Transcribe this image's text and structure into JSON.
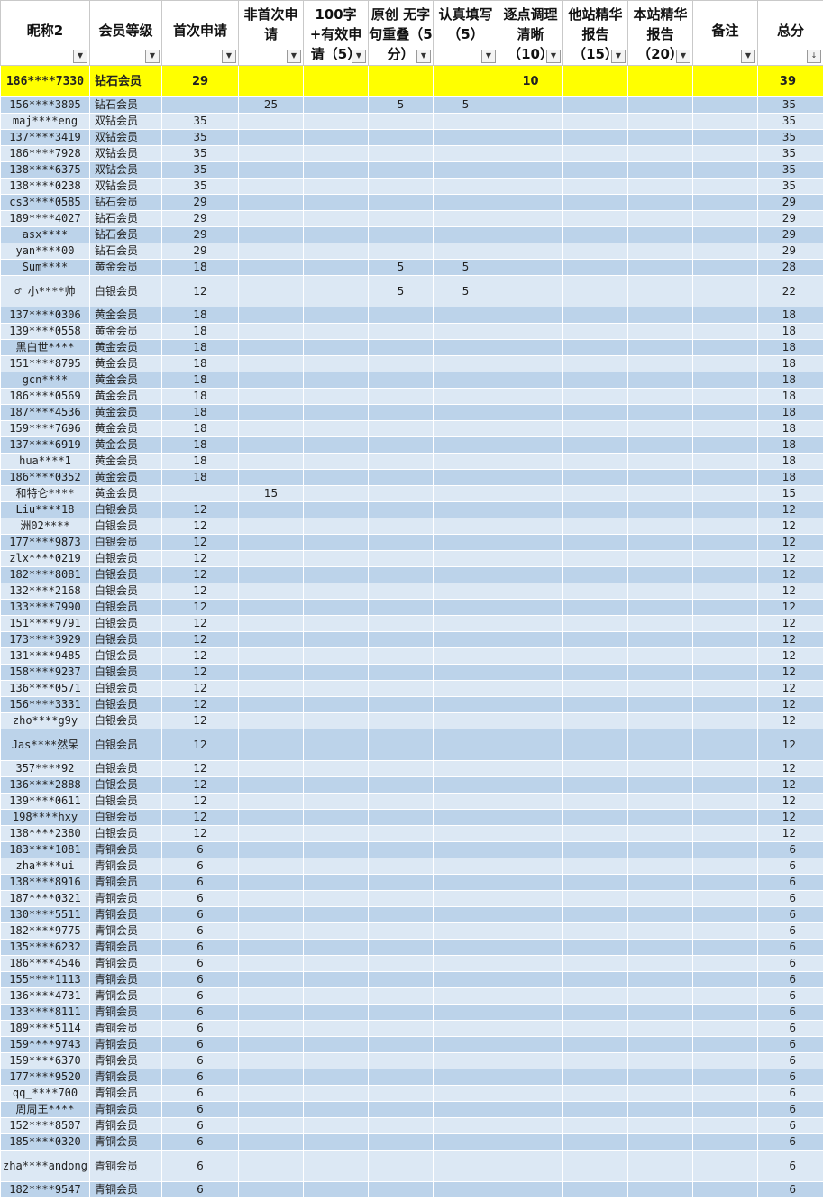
{
  "headers": [
    {
      "label": "昵称2",
      "lines": 1
    },
    {
      "label": "会员等级",
      "lines": 1
    },
    {
      "label": "首次申请",
      "lines": 1
    },
    {
      "label": "非首次申请",
      "lines": 2
    },
    {
      "label": "100字+有效申请（5）",
      "lines": 3
    },
    {
      "label": "原创 无字句重叠（5分）",
      "lines": 3
    },
    {
      "label": "认真填写（5）",
      "lines": 2
    },
    {
      "label": "逐点调理清晰（10）",
      "lines": 3
    },
    {
      "label": "他站精华报告（15）",
      "lines": 3
    },
    {
      "label": "本站精华报告（20）",
      "lines": 3
    },
    {
      "label": "备注",
      "lines": 1
    },
    {
      "label": "总分",
      "lines": 1
    }
  ],
  "sort_icon": "sort-desc",
  "filter_icon": "dropdown-arrow",
  "rows": [
    {
      "name": "186****7330",
      "level": "钻石会员",
      "first": "29",
      "nonfirst": "",
      "valid100": "",
      "original": "",
      "careful": "",
      "clear": "10",
      "other": "",
      "local": "",
      "note": "",
      "total": "39",
      "style": "hl"
    },
    {
      "name": "156****3805",
      "level": "钻石会员",
      "first": "",
      "nonfirst": "25",
      "valid100": "",
      "original": "5",
      "careful": "5",
      "clear": "",
      "other": "",
      "local": "",
      "note": "",
      "total": "35"
    },
    {
      "name": "maj****eng",
      "level": "双钻会员",
      "first": "35",
      "nonfirst": "",
      "valid100": "",
      "original": "",
      "careful": "",
      "clear": "",
      "other": "",
      "local": "",
      "note": "",
      "total": "35"
    },
    {
      "name": "137****3419",
      "level": "双钻会员",
      "first": "35",
      "nonfirst": "",
      "valid100": "",
      "original": "",
      "careful": "",
      "clear": "",
      "other": "",
      "local": "",
      "note": "",
      "total": "35"
    },
    {
      "name": "186****7928",
      "level": "双钻会员",
      "first": "35",
      "nonfirst": "",
      "valid100": "",
      "original": "",
      "careful": "",
      "clear": "",
      "other": "",
      "local": "",
      "note": "",
      "total": "35"
    },
    {
      "name": "138****6375",
      "level": "双钻会员",
      "first": "35",
      "nonfirst": "",
      "valid100": "",
      "original": "",
      "careful": "",
      "clear": "",
      "other": "",
      "local": "",
      "note": "",
      "total": "35"
    },
    {
      "name": "138****0238",
      "level": "双钻会员",
      "first": "35",
      "nonfirst": "",
      "valid100": "",
      "original": "",
      "careful": "",
      "clear": "",
      "other": "",
      "local": "",
      "note": "",
      "total": "35"
    },
    {
      "name": "cs3****0585",
      "level": "钻石会员",
      "first": "29",
      "nonfirst": "",
      "valid100": "",
      "original": "",
      "careful": "",
      "clear": "",
      "other": "",
      "local": "",
      "note": "",
      "total": "29"
    },
    {
      "name": "189****4027",
      "level": "钻石会员",
      "first": "29",
      "nonfirst": "",
      "valid100": "",
      "original": "",
      "careful": "",
      "clear": "",
      "other": "",
      "local": "",
      "note": "",
      "total": "29"
    },
    {
      "name": "asx****",
      "level": "钻石会员",
      "first": "29",
      "nonfirst": "",
      "valid100": "",
      "original": "",
      "careful": "",
      "clear": "",
      "other": "",
      "local": "",
      "note": "",
      "total": "29"
    },
    {
      "name": "yan****00",
      "level": "钻石会员",
      "first": "29",
      "nonfirst": "",
      "valid100": "",
      "original": "",
      "careful": "",
      "clear": "",
      "other": "",
      "local": "",
      "note": "",
      "total": "29"
    },
    {
      "name": "Sum****",
      "level": "黄金会员",
      "first": "18",
      "nonfirst": "",
      "valid100": "",
      "original": "5",
      "careful": "5",
      "clear": "",
      "other": "",
      "local": "",
      "note": "",
      "total": "28"
    },
    {
      "name": "♂ 小****帅",
      "level": "白银会员",
      "first": "12",
      "nonfirst": "",
      "valid100": "",
      "original": "5",
      "careful": "5",
      "clear": "",
      "other": "",
      "local": "",
      "note": "",
      "total": "22",
      "style": "tall"
    },
    {
      "name": "137****0306",
      "level": "黄金会员",
      "first": "18",
      "nonfirst": "",
      "valid100": "",
      "original": "",
      "careful": "",
      "clear": "",
      "other": "",
      "local": "",
      "note": "",
      "total": "18"
    },
    {
      "name": "139****0558",
      "level": "黄金会员",
      "first": "18",
      "nonfirst": "",
      "valid100": "",
      "original": "",
      "careful": "",
      "clear": "",
      "other": "",
      "local": "",
      "note": "",
      "total": "18"
    },
    {
      "name": "黑白世****",
      "level": "黄金会员",
      "first": "18",
      "nonfirst": "",
      "valid100": "",
      "original": "",
      "careful": "",
      "clear": "",
      "other": "",
      "local": "",
      "note": "",
      "total": "18"
    },
    {
      "name": "151****8795",
      "level": "黄金会员",
      "first": "18",
      "nonfirst": "",
      "valid100": "",
      "original": "",
      "careful": "",
      "clear": "",
      "other": "",
      "local": "",
      "note": "",
      "total": "18"
    },
    {
      "name": "gcn****",
      "level": "黄金会员",
      "first": "18",
      "nonfirst": "",
      "valid100": "",
      "original": "",
      "careful": "",
      "clear": "",
      "other": "",
      "local": "",
      "note": "",
      "total": "18"
    },
    {
      "name": "186****0569",
      "level": "黄金会员",
      "first": "18",
      "nonfirst": "",
      "valid100": "",
      "original": "",
      "careful": "",
      "clear": "",
      "other": "",
      "local": "",
      "note": "",
      "total": "18"
    },
    {
      "name": "187****4536",
      "level": "黄金会员",
      "first": "18",
      "nonfirst": "",
      "valid100": "",
      "original": "",
      "careful": "",
      "clear": "",
      "other": "",
      "local": "",
      "note": "",
      "total": "18"
    },
    {
      "name": "159****7696",
      "level": "黄金会员",
      "first": "18",
      "nonfirst": "",
      "valid100": "",
      "original": "",
      "careful": "",
      "clear": "",
      "other": "",
      "local": "",
      "note": "",
      "total": "18"
    },
    {
      "name": "137****6919",
      "level": "黄金会员",
      "first": "18",
      "nonfirst": "",
      "valid100": "",
      "original": "",
      "careful": "",
      "clear": "",
      "other": "",
      "local": "",
      "note": "",
      "total": "18"
    },
    {
      "name": "hua****1",
      "level": "黄金会员",
      "first": "18",
      "nonfirst": "",
      "valid100": "",
      "original": "",
      "careful": "",
      "clear": "",
      "other": "",
      "local": "",
      "note": "",
      "total": "18"
    },
    {
      "name": "186****0352",
      "level": "黄金会员",
      "first": "18",
      "nonfirst": "",
      "valid100": "",
      "original": "",
      "careful": "",
      "clear": "",
      "other": "",
      "local": "",
      "note": "",
      "total": "18"
    },
    {
      "name": "和特仑****",
      "level": "黄金会员",
      "first": "",
      "nonfirst": "15",
      "valid100": "",
      "original": "",
      "careful": "",
      "clear": "",
      "other": "",
      "local": "",
      "note": "",
      "total": "15"
    },
    {
      "name": "Liu****18",
      "level": "白银会员",
      "first": "12",
      "nonfirst": "",
      "valid100": "",
      "original": "",
      "careful": "",
      "clear": "",
      "other": "",
      "local": "",
      "note": "",
      "total": "12"
    },
    {
      "name": "洲02****",
      "level": "白银会员",
      "first": "12",
      "nonfirst": "",
      "valid100": "",
      "original": "",
      "careful": "",
      "clear": "",
      "other": "",
      "local": "",
      "note": "",
      "total": "12"
    },
    {
      "name": "177****9873",
      "level": "白银会员",
      "first": "12",
      "nonfirst": "",
      "valid100": "",
      "original": "",
      "careful": "",
      "clear": "",
      "other": "",
      "local": "",
      "note": "",
      "total": "12"
    },
    {
      "name": "zlx****0219",
      "level": "白银会员",
      "first": "12",
      "nonfirst": "",
      "valid100": "",
      "original": "",
      "careful": "",
      "clear": "",
      "other": "",
      "local": "",
      "note": "",
      "total": "12"
    },
    {
      "name": "182****8081",
      "level": "白银会员",
      "first": "12",
      "nonfirst": "",
      "valid100": "",
      "original": "",
      "careful": "",
      "clear": "",
      "other": "",
      "local": "",
      "note": "",
      "total": "12"
    },
    {
      "name": "132****2168",
      "level": "白银会员",
      "first": "12",
      "nonfirst": "",
      "valid100": "",
      "original": "",
      "careful": "",
      "clear": "",
      "other": "",
      "local": "",
      "note": "",
      "total": "12"
    },
    {
      "name": "133****7990",
      "level": "白银会员",
      "first": "12",
      "nonfirst": "",
      "valid100": "",
      "original": "",
      "careful": "",
      "clear": "",
      "other": "",
      "local": "",
      "note": "",
      "total": "12"
    },
    {
      "name": "151****9791",
      "level": "白银会员",
      "first": "12",
      "nonfirst": "",
      "valid100": "",
      "original": "",
      "careful": "",
      "clear": "",
      "other": "",
      "local": "",
      "note": "",
      "total": "12"
    },
    {
      "name": "173****3929",
      "level": "白银会员",
      "first": "12",
      "nonfirst": "",
      "valid100": "",
      "original": "",
      "careful": "",
      "clear": "",
      "other": "",
      "local": "",
      "note": "",
      "total": "12"
    },
    {
      "name": "131****9485",
      "level": "白银会员",
      "first": "12",
      "nonfirst": "",
      "valid100": "",
      "original": "",
      "careful": "",
      "clear": "",
      "other": "",
      "local": "",
      "note": "",
      "total": "12"
    },
    {
      "name": "158****9237",
      "level": "白银会员",
      "first": "12",
      "nonfirst": "",
      "valid100": "",
      "original": "",
      "careful": "",
      "clear": "",
      "other": "",
      "local": "",
      "note": "",
      "total": "12"
    },
    {
      "name": "136****0571",
      "level": "白银会员",
      "first": "12",
      "nonfirst": "",
      "valid100": "",
      "original": "",
      "careful": "",
      "clear": "",
      "other": "",
      "local": "",
      "note": "",
      "total": "12"
    },
    {
      "name": "156****3331",
      "level": "白银会员",
      "first": "12",
      "nonfirst": "",
      "valid100": "",
      "original": "",
      "careful": "",
      "clear": "",
      "other": "",
      "local": "",
      "note": "",
      "total": "12"
    },
    {
      "name": "zho****g9y",
      "level": "白银会员",
      "first": "12",
      "nonfirst": "",
      "valid100": "",
      "original": "",
      "careful": "",
      "clear": "",
      "other": "",
      "local": "",
      "note": "",
      "total": "12"
    },
    {
      "name": "Jas****然呆",
      "level": "白银会员",
      "first": "12",
      "nonfirst": "",
      "valid100": "",
      "original": "",
      "careful": "",
      "clear": "",
      "other": "",
      "local": "",
      "note": "",
      "total": "12",
      "style": "tall"
    },
    {
      "name": "357****92",
      "level": "白银会员",
      "first": "12",
      "nonfirst": "",
      "valid100": "",
      "original": "",
      "careful": "",
      "clear": "",
      "other": "",
      "local": "",
      "note": "",
      "total": "12"
    },
    {
      "name": "136****2888",
      "level": "白银会员",
      "first": "12",
      "nonfirst": "",
      "valid100": "",
      "original": "",
      "careful": "",
      "clear": "",
      "other": "",
      "local": "",
      "note": "",
      "total": "12"
    },
    {
      "name": "139****0611",
      "level": "白银会员",
      "first": "12",
      "nonfirst": "",
      "valid100": "",
      "original": "",
      "careful": "",
      "clear": "",
      "other": "",
      "local": "",
      "note": "",
      "total": "12"
    },
    {
      "name": "198****hxy",
      "level": "白银会员",
      "first": "12",
      "nonfirst": "",
      "valid100": "",
      "original": "",
      "careful": "",
      "clear": "",
      "other": "",
      "local": "",
      "note": "",
      "total": "12"
    },
    {
      "name": "138****2380",
      "level": "白银会员",
      "first": "12",
      "nonfirst": "",
      "valid100": "",
      "original": "",
      "careful": "",
      "clear": "",
      "other": "",
      "local": "",
      "note": "",
      "total": "12"
    },
    {
      "name": "183****1081",
      "level": "青铜会员",
      "first": "6",
      "nonfirst": "",
      "valid100": "",
      "original": "",
      "careful": "",
      "clear": "",
      "other": "",
      "local": "",
      "note": "",
      "total": "6"
    },
    {
      "name": "zha****ui",
      "level": "青铜会员",
      "first": "6",
      "nonfirst": "",
      "valid100": "",
      "original": "",
      "careful": "",
      "clear": "",
      "other": "",
      "local": "",
      "note": "",
      "total": "6"
    },
    {
      "name": "138****8916",
      "level": "青铜会员",
      "first": "6",
      "nonfirst": "",
      "valid100": "",
      "original": "",
      "careful": "",
      "clear": "",
      "other": "",
      "local": "",
      "note": "",
      "total": "6"
    },
    {
      "name": "187****0321",
      "level": "青铜会员",
      "first": "6",
      "nonfirst": "",
      "valid100": "",
      "original": "",
      "careful": "",
      "clear": "",
      "other": "",
      "local": "",
      "note": "",
      "total": "6"
    },
    {
      "name": "130****5511",
      "level": "青铜会员",
      "first": "6",
      "nonfirst": "",
      "valid100": "",
      "original": "",
      "careful": "",
      "clear": "",
      "other": "",
      "local": "",
      "note": "",
      "total": "6"
    },
    {
      "name": "182****9775",
      "level": "青铜会员",
      "first": "6",
      "nonfirst": "",
      "valid100": "",
      "original": "",
      "careful": "",
      "clear": "",
      "other": "",
      "local": "",
      "note": "",
      "total": "6"
    },
    {
      "name": "135****6232",
      "level": "青铜会员",
      "first": "6",
      "nonfirst": "",
      "valid100": "",
      "original": "",
      "careful": "",
      "clear": "",
      "other": "",
      "local": "",
      "note": "",
      "total": "6"
    },
    {
      "name": "186****4546",
      "level": "青铜会员",
      "first": "6",
      "nonfirst": "",
      "valid100": "",
      "original": "",
      "careful": "",
      "clear": "",
      "other": "",
      "local": "",
      "note": "",
      "total": "6"
    },
    {
      "name": "155****1113",
      "level": "青铜会员",
      "first": "6",
      "nonfirst": "",
      "valid100": "",
      "original": "",
      "careful": "",
      "clear": "",
      "other": "",
      "local": "",
      "note": "",
      "total": "6"
    },
    {
      "name": "136****4731",
      "level": "青铜会员",
      "first": "6",
      "nonfirst": "",
      "valid100": "",
      "original": "",
      "careful": "",
      "clear": "",
      "other": "",
      "local": "",
      "note": "",
      "total": "6"
    },
    {
      "name": "133****8111",
      "level": "青铜会员",
      "first": "6",
      "nonfirst": "",
      "valid100": "",
      "original": "",
      "careful": "",
      "clear": "",
      "other": "",
      "local": "",
      "note": "",
      "total": "6"
    },
    {
      "name": "189****5114",
      "level": "青铜会员",
      "first": "6",
      "nonfirst": "",
      "valid100": "",
      "original": "",
      "careful": "",
      "clear": "",
      "other": "",
      "local": "",
      "note": "",
      "total": "6"
    },
    {
      "name": "159****9743",
      "level": "青铜会员",
      "first": "6",
      "nonfirst": "",
      "valid100": "",
      "original": "",
      "careful": "",
      "clear": "",
      "other": "",
      "local": "",
      "note": "",
      "total": "6"
    },
    {
      "name": "159****6370",
      "level": "青铜会员",
      "first": "6",
      "nonfirst": "",
      "valid100": "",
      "original": "",
      "careful": "",
      "clear": "",
      "other": "",
      "local": "",
      "note": "",
      "total": "6"
    },
    {
      "name": "177****9520",
      "level": "青铜会员",
      "first": "6",
      "nonfirst": "",
      "valid100": "",
      "original": "",
      "careful": "",
      "clear": "",
      "other": "",
      "local": "",
      "note": "",
      "total": "6"
    },
    {
      "name": "qq_****700",
      "level": "青铜会员",
      "first": "6",
      "nonfirst": "",
      "valid100": "",
      "original": "",
      "careful": "",
      "clear": "",
      "other": "",
      "local": "",
      "note": "",
      "total": "6"
    },
    {
      "name": "周周王****",
      "level": "青铜会员",
      "first": "6",
      "nonfirst": "",
      "valid100": "",
      "original": "",
      "careful": "",
      "clear": "",
      "other": "",
      "local": "",
      "note": "",
      "total": "6"
    },
    {
      "name": "152****8507",
      "level": "青铜会员",
      "first": "6",
      "nonfirst": "",
      "valid100": "",
      "original": "",
      "careful": "",
      "clear": "",
      "other": "",
      "local": "",
      "note": "",
      "total": "6"
    },
    {
      "name": "185****0320",
      "level": "青铜会员",
      "first": "6",
      "nonfirst": "",
      "valid100": "",
      "original": "",
      "careful": "",
      "clear": "",
      "other": "",
      "local": "",
      "note": "",
      "total": "6"
    },
    {
      "name": "zha****andong",
      "level": "青铜会员",
      "first": "6",
      "nonfirst": "",
      "valid100": "",
      "original": "",
      "careful": "",
      "clear": "",
      "other": "",
      "local": "",
      "note": "",
      "total": "6",
      "style": "tall"
    },
    {
      "name": "182****9547",
      "level": "青铜会员",
      "first": "6",
      "nonfirst": "",
      "valid100": "",
      "original": "",
      "careful": "",
      "clear": "",
      "other": "",
      "local": "",
      "note": "",
      "total": "6"
    }
  ]
}
